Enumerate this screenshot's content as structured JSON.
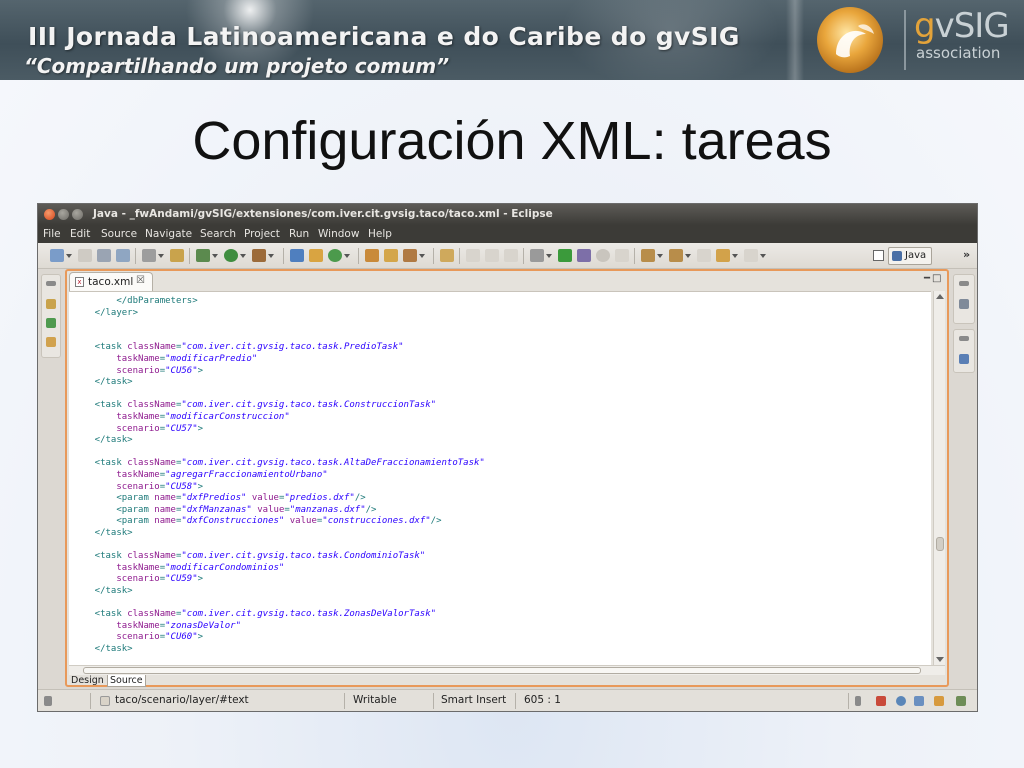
{
  "banner": {
    "title": "III Jornada Latinoamericana e do Caribe do gvSIG",
    "subtitle": "“Compartilhando um projeto comum”",
    "logo_g": "g",
    "logo_rest": "vSIG",
    "logo_association": "association"
  },
  "slide": {
    "title": "Configuración XML: tareas"
  },
  "window": {
    "title": "Java - _fwAndami/gvSIG/extensiones/com.iver.cit.gvsig.taco/taco.xml - Eclipse"
  },
  "menu": [
    "File",
    "Edit",
    "Source",
    "Navigate",
    "Search",
    "Project",
    "Run",
    "Window",
    "Help"
  ],
  "toolbar": {
    "perspective_label": "Java",
    "overflow": "»"
  },
  "editor": {
    "tab_label": "taco.xml",
    "tab_close": "☒",
    "minmax": "━□",
    "bottom_tabs": [
      "Design",
      "Source"
    ],
    "lines": [
      [
        [
          "t",
          "        </dbParameters>"
        ]
      ],
      [
        [
          "t",
          "    </layer>"
        ]
      ],
      [],
      [],
      [
        [
          "t",
          "    <task "
        ],
        [
          "a",
          "className"
        ],
        [
          "p",
          "="
        ],
        [
          "v",
          "\"com.iver.cit.gvsig.taco.task.PredioTask\""
        ]
      ],
      [
        [
          "a",
          "        taskName"
        ],
        [
          "p",
          "="
        ],
        [
          "v",
          "\"modificarPredio\""
        ]
      ],
      [
        [
          "a",
          "        scenario"
        ],
        [
          "p",
          "="
        ],
        [
          "v",
          "\"CU56\""
        ],
        [
          "t",
          ">"
        ]
      ],
      [
        [
          "t",
          "    </task>"
        ]
      ],
      [],
      [
        [
          "t",
          "    <task "
        ],
        [
          "a",
          "className"
        ],
        [
          "p",
          "="
        ],
        [
          "v",
          "\"com.iver.cit.gvsig.taco.task.ConstruccionTask\""
        ]
      ],
      [
        [
          "a",
          "        taskName"
        ],
        [
          "p",
          "="
        ],
        [
          "v",
          "\"modificarConstruccion\""
        ]
      ],
      [
        [
          "a",
          "        scenario"
        ],
        [
          "p",
          "="
        ],
        [
          "v",
          "\"CU57\""
        ],
        [
          "t",
          ">"
        ]
      ],
      [
        [
          "t",
          "    </task>"
        ]
      ],
      [],
      [
        [
          "t",
          "    <task "
        ],
        [
          "a",
          "className"
        ],
        [
          "p",
          "="
        ],
        [
          "v",
          "\"com.iver.cit.gvsig.taco.task.AltaDeFraccionamientoTask\""
        ]
      ],
      [
        [
          "a",
          "        taskName"
        ],
        [
          "p",
          "="
        ],
        [
          "v",
          "\"agregarFraccionamientoUrbano\""
        ]
      ],
      [
        [
          "a",
          "        scenario"
        ],
        [
          "p",
          "="
        ],
        [
          "v",
          "\"CU58\""
        ],
        [
          "t",
          ">"
        ]
      ],
      [
        [
          "t",
          "        <param "
        ],
        [
          "a",
          "name"
        ],
        [
          "p",
          "="
        ],
        [
          "v",
          "\"dxfPredios\""
        ],
        [
          "t",
          " "
        ],
        [
          "a",
          "value"
        ],
        [
          "p",
          "="
        ],
        [
          "v",
          "\"predios.dxf\""
        ],
        [
          "t",
          "/>"
        ]
      ],
      [
        [
          "t",
          "        <param "
        ],
        [
          "a",
          "name"
        ],
        [
          "p",
          "="
        ],
        [
          "v",
          "\"dxfManzanas\""
        ],
        [
          "t",
          " "
        ],
        [
          "a",
          "value"
        ],
        [
          "p",
          "="
        ],
        [
          "v",
          "\"manzanas.dxf\""
        ],
        [
          "t",
          "/>"
        ]
      ],
      [
        [
          "t",
          "        <param "
        ],
        [
          "a",
          "name"
        ],
        [
          "p",
          "="
        ],
        [
          "v",
          "\"dxfConstrucciones\""
        ],
        [
          "t",
          " "
        ],
        [
          "a",
          "value"
        ],
        [
          "p",
          "="
        ],
        [
          "v",
          "\"construcciones.dxf\""
        ],
        [
          "t",
          "/>"
        ]
      ],
      [
        [
          "t",
          "    </task>"
        ]
      ],
      [],
      [
        [
          "t",
          "    <task "
        ],
        [
          "a",
          "className"
        ],
        [
          "p",
          "="
        ],
        [
          "v",
          "\"com.iver.cit.gvsig.taco.task.CondominioTask\""
        ]
      ],
      [
        [
          "a",
          "        taskName"
        ],
        [
          "p",
          "="
        ],
        [
          "v",
          "\"modificarCondominios\""
        ]
      ],
      [
        [
          "a",
          "        scenario"
        ],
        [
          "p",
          "="
        ],
        [
          "v",
          "\"CU59\""
        ],
        [
          "t",
          ">"
        ]
      ],
      [
        [
          "t",
          "    </task>"
        ]
      ],
      [],
      [
        [
          "t",
          "    <task "
        ],
        [
          "a",
          "className"
        ],
        [
          "p",
          "="
        ],
        [
          "v",
          "\"com.iver.cit.gvsig.taco.task.ZonasDeValorTask\""
        ]
      ],
      [
        [
          "a",
          "        taskName"
        ],
        [
          "p",
          "="
        ],
        [
          "v",
          "\"zonasDeValor\""
        ]
      ],
      [
        [
          "a",
          "        scenario"
        ],
        [
          "p",
          "="
        ],
        [
          "v",
          "\"CU60\""
        ],
        [
          "t",
          ">"
        ]
      ],
      [
        [
          "t",
          "    </task>"
        ]
      ]
    ]
  },
  "status": {
    "path": "taco/scenario/layer/#text",
    "mode": "Writable",
    "insert": "Smart Insert",
    "position": "605 : 1"
  },
  "colors": {
    "xml_tag": "#1e7a7a",
    "xml_attr": "#8e1a8e",
    "xml_value": "#2a00ff",
    "editor_border": "#e8995a",
    "logo_orange": "#e3a33a"
  }
}
